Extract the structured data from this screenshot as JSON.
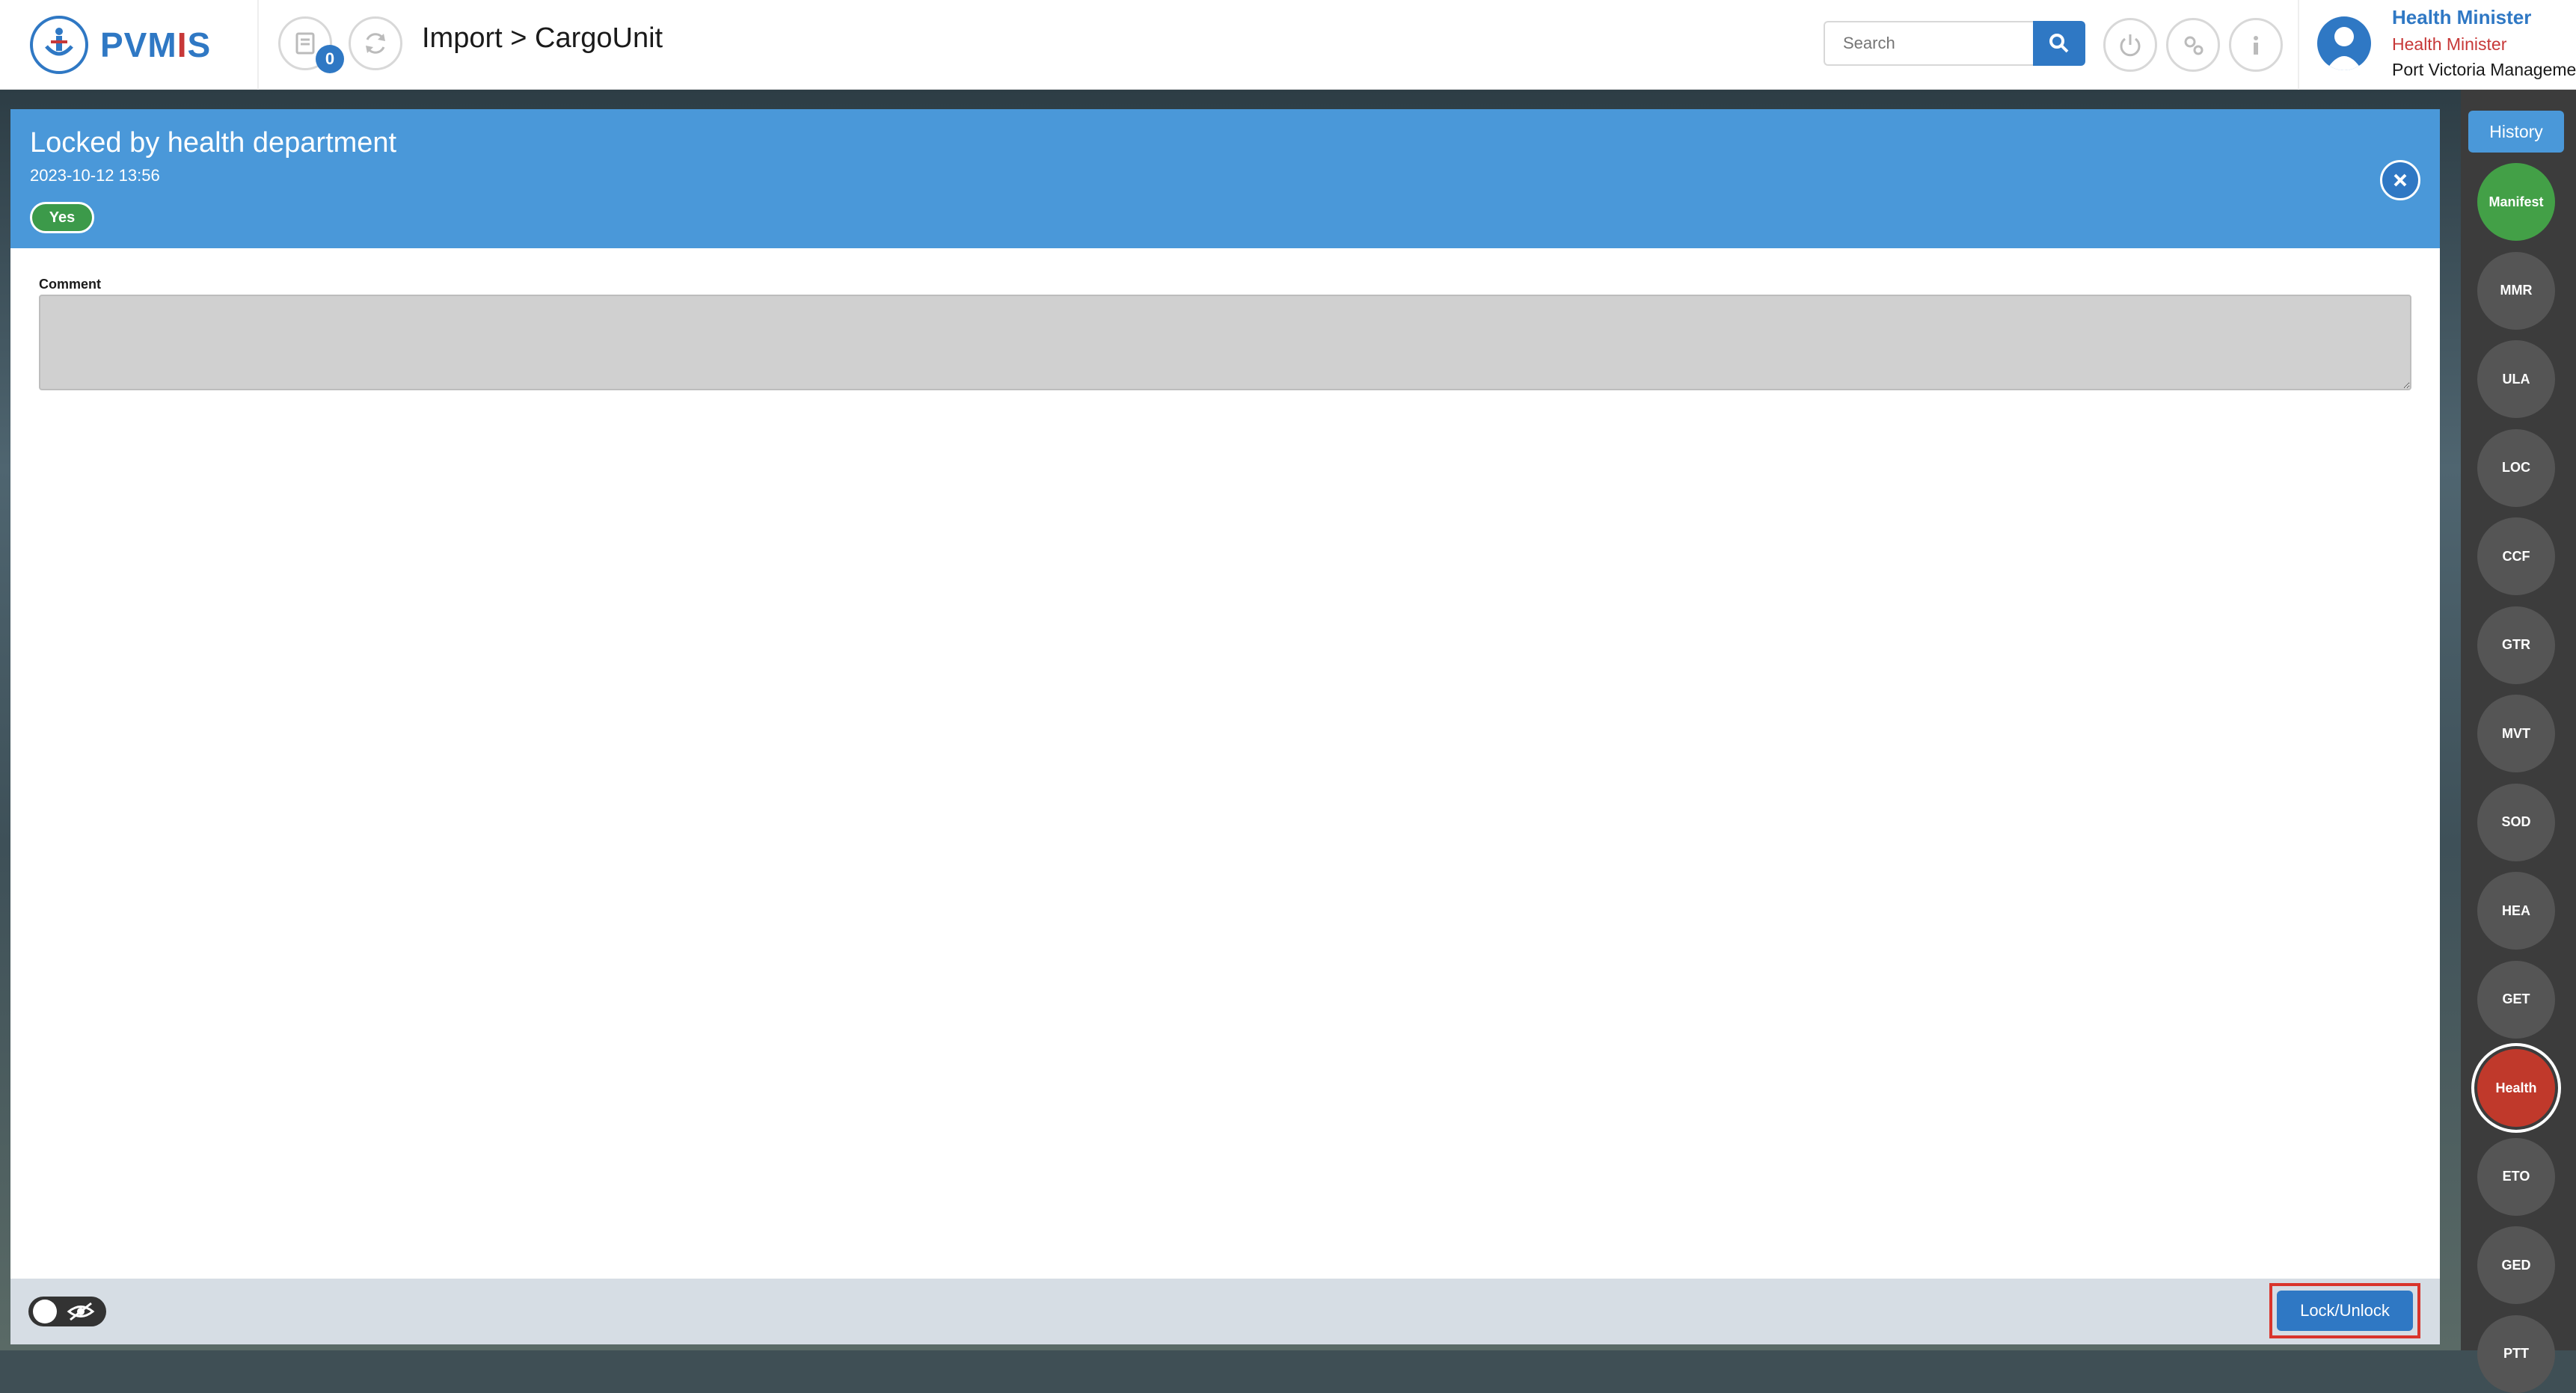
{
  "header": {
    "logo_text_left": "PVM",
    "logo_text_i": "I",
    "logo_text_right": "S",
    "notification_count": "0",
    "breadcrumb": "Import > CargoUnit",
    "search_placeholder": "Search",
    "icons": [
      "document-icon",
      "refresh-icon",
      "search-icon",
      "power-icon",
      "settings-icon",
      "info-icon"
    ]
  },
  "user": {
    "name": "Health Minister",
    "role": "Health Minister",
    "organization": "Port Victoria Management"
  },
  "dialog": {
    "title": "Locked by health department",
    "date": "2023-10-12 13:56",
    "status_label": "Yes",
    "comment_label": "Comment",
    "comment_value": "",
    "lock_button_label": "Lock/Unlock"
  },
  "rail": {
    "history_label": "History",
    "items": [
      {
        "label": "Manifest",
        "state": "done"
      },
      {
        "label": "MMR",
        "state": "default"
      },
      {
        "label": "ULA",
        "state": "default"
      },
      {
        "label": "LOC",
        "state": "default"
      },
      {
        "label": "CCF",
        "state": "default"
      },
      {
        "label": "GTR",
        "state": "default"
      },
      {
        "label": "MVT",
        "state": "default"
      },
      {
        "label": "SOD",
        "state": "default"
      },
      {
        "label": "HEA",
        "state": "default"
      },
      {
        "label": "GET",
        "state": "default"
      },
      {
        "label": "Health",
        "state": "active"
      },
      {
        "label": "ETO",
        "state": "default"
      },
      {
        "label": "GED",
        "state": "default"
      },
      {
        "label": "PTT",
        "state": "default"
      }
    ]
  },
  "colors": {
    "primary": "#2f78c4",
    "header_blue": "#4a98d9",
    "success": "#43a047",
    "danger": "#c0392b"
  }
}
